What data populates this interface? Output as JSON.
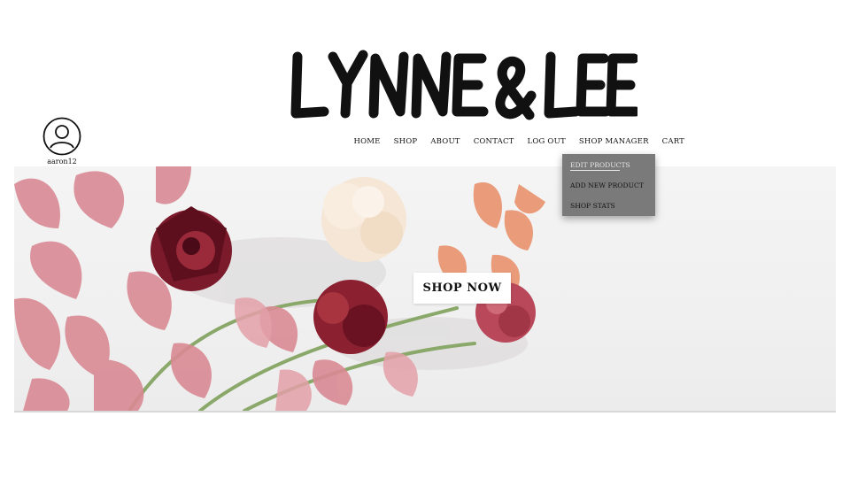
{
  "brand": {
    "logo_text": "LYNNE & LEE"
  },
  "user": {
    "username": "aaron12",
    "icon": "user-avatar-icon"
  },
  "nav": {
    "items": [
      {
        "label": "HOME"
      },
      {
        "label": "SHOP"
      },
      {
        "label": "ABOUT"
      },
      {
        "label": "CONTACT"
      },
      {
        "label": "LOG OUT"
      },
      {
        "label": "SHOP MANAGER"
      },
      {
        "label": "CART"
      }
    ]
  },
  "shop_manager_menu": {
    "items": [
      {
        "label": "EDIT PRODUCTS",
        "active": true
      },
      {
        "label": "ADD NEW PRODUCT"
      },
      {
        "label": "SHOP STATS"
      }
    ]
  },
  "hero": {
    "button_label": "SHOP NOW",
    "image_description_icon": "flowers-photo"
  },
  "colors": {
    "dropdown_bg": "#7a7a7a",
    "text": "#111111",
    "hero_bg": "#f2f2f2",
    "leaf_pink": "#d98a94",
    "flower_dark": "#7a1a2a",
    "flower_cream": "#f6e6d6"
  }
}
